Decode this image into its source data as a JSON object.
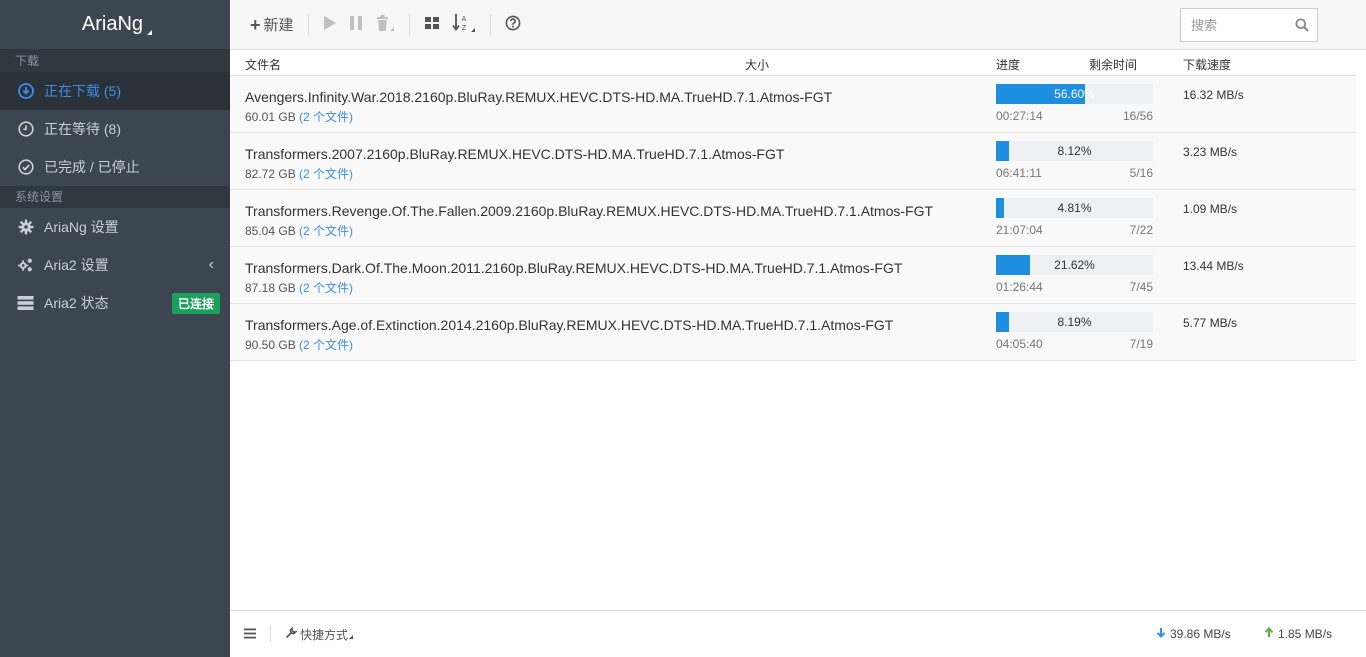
{
  "app": {
    "title": "AriaNg"
  },
  "sidebar": {
    "sections": [
      {
        "header": "下载"
      },
      {
        "header": "系统设置"
      }
    ],
    "items": [
      {
        "label": "正在下载 (5)",
        "icon": "download-circle-icon"
      },
      {
        "label": "正在等待 (8)",
        "icon": "clock-icon"
      },
      {
        "label": "已完成 / 已停止",
        "icon": "check-circle-icon"
      },
      {
        "label": "AriaNg 设置",
        "icon": "gear-icon"
      },
      {
        "label": "Aria2 设置",
        "icon": "gears-icon"
      },
      {
        "label": "Aria2 状态",
        "icon": "server-icon",
        "badge": "已连接"
      }
    ]
  },
  "toolbar": {
    "new_label": "新建",
    "search_placeholder": "搜索"
  },
  "table": {
    "headers": {
      "name": "文件名",
      "size": "大小",
      "progress": "进度",
      "remaining": "剩余时间",
      "speed": "下载速度"
    },
    "rows": [
      {
        "name": "Avengers.Infinity.War.2018.2160p.BluRay.REMUX.HEVC.DTS-HD.MA.TrueHD.7.1.Atmos-FGT",
        "size": "60.01 GB",
        "files": "(2 个文件)",
        "progress": 56.6,
        "progress_text": "56.60%",
        "remaining": "00:27:14",
        "connections": "16/56",
        "speed": "16.32 MB/s"
      },
      {
        "name": "Transformers.2007.2160p.BluRay.REMUX.HEVC.DTS-HD.MA.TrueHD.7.1.Atmos-FGT",
        "size": "82.72 GB",
        "files": "(2 个文件)",
        "progress": 8.12,
        "progress_text": "8.12%",
        "remaining": "06:41:11",
        "connections": "5/16",
        "speed": "3.23 MB/s"
      },
      {
        "name": "Transformers.Revenge.Of.The.Fallen.2009.2160p.BluRay.REMUX.HEVC.DTS-HD.MA.TrueHD.7.1.Atmos-FGT",
        "size": "85.04 GB",
        "files": "(2 个文件)",
        "progress": 4.81,
        "progress_text": "4.81%",
        "remaining": "21:07:04",
        "connections": "7/22",
        "speed": "1.09 MB/s"
      },
      {
        "name": "Transformers.Dark.Of.The.Moon.2011.2160p.BluRay.REMUX.HEVC.DTS-HD.MA.TrueHD.7.1.Atmos-FGT",
        "size": "87.18 GB",
        "files": "(2 个文件)",
        "progress": 21.62,
        "progress_text": "21.62%",
        "remaining": "01:26:44",
        "connections": "7/45",
        "speed": "13.44 MB/s"
      },
      {
        "name": "Transformers.Age.of.Extinction.2014.2160p.BluRay.REMUX.HEVC.DTS-HD.MA.TrueHD.7.1.Atmos-FGT",
        "size": "90.50 GB",
        "files": "(2 个文件)",
        "progress": 8.19,
        "progress_text": "8.19%",
        "remaining": "04:05:40",
        "connections": "7/19",
        "speed": "5.77 MB/s"
      }
    ]
  },
  "footer": {
    "quick_label": "快捷方式",
    "download_speed": "39.86 MB/s",
    "upload_speed": "1.85 MB/s"
  },
  "colors": {
    "accent": "#1e8ee0",
    "sidebar_bg": "#3c4650",
    "badge_green": "#1aa05a"
  }
}
